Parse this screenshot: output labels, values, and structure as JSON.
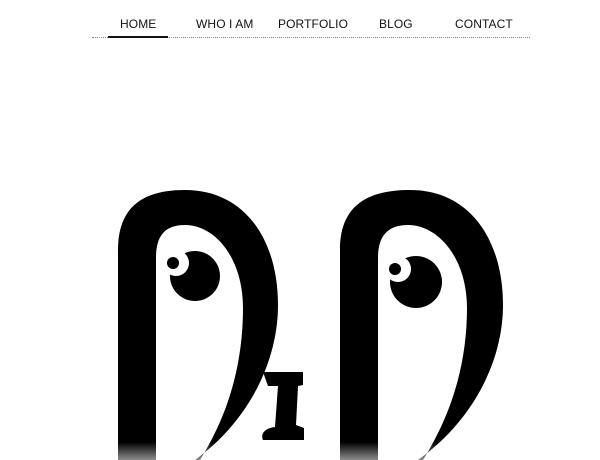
{
  "nav": {
    "items": [
      {
        "label": "HOME",
        "active": true
      },
      {
        "label": "WHO I AM",
        "active": false
      },
      {
        "label": "PORTFOLIO",
        "active": false
      },
      {
        "label": "BLOG",
        "active": false
      },
      {
        "label": "CONTACT",
        "active": false
      }
    ]
  },
  "logo": {
    "icon": "dd-eyes-logo",
    "color": "#000000"
  }
}
